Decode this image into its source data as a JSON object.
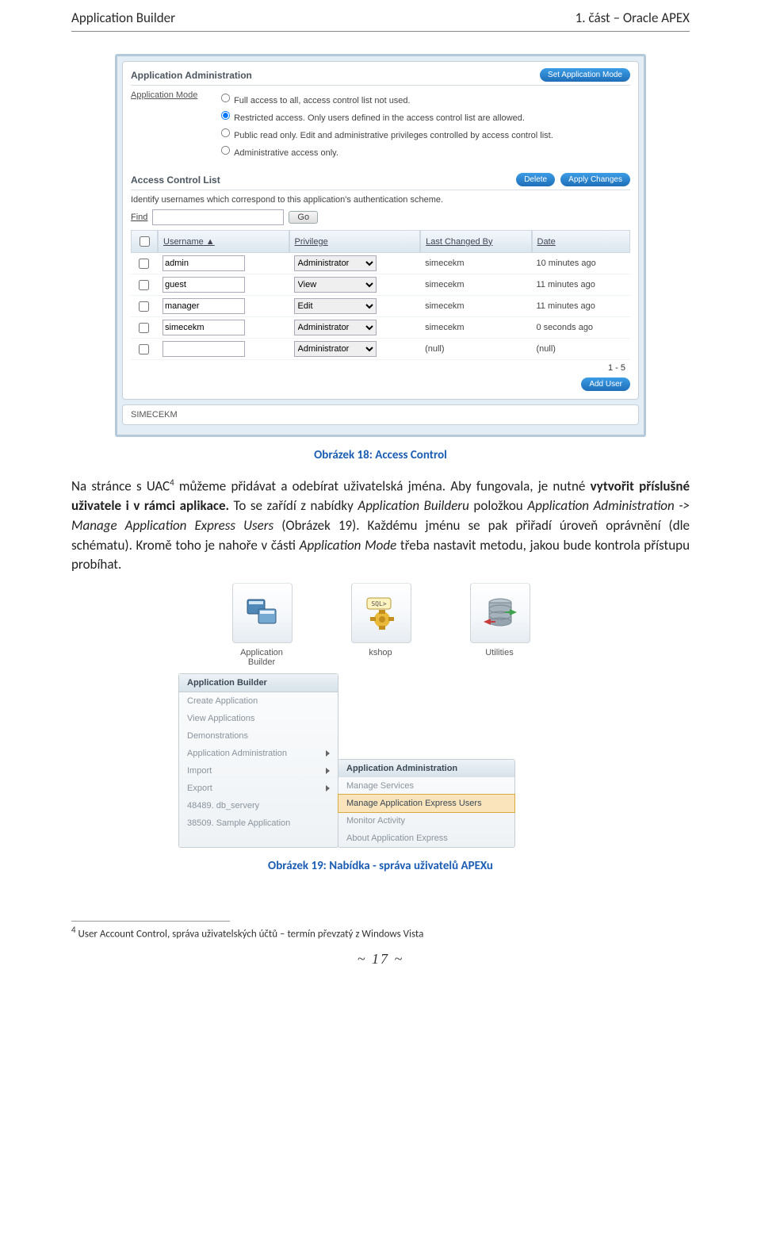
{
  "header": {
    "left": "Application Builder",
    "right": "1. část – Oracle APEX"
  },
  "caption1": "Obrázek 18: Access Control",
  "para1a": "Na stránce s UAC",
  "para1sup": "4",
  "para1b": " můžeme přidávat a odebírat uživatelská jména. Aby fungovala, je nutné ",
  "para1bold": "vytvořit příslušné uživatele i v rámci aplikace.",
  "para1c": " To se zařídí z nabídky ",
  "para1i1": "Application Builderu",
  "para1d": " položkou ",
  "para1i2": "Application Administration -> Manage Application Express Users",
  "para1e": " (Obrázek 19). Každému jménu se pak přiřadí úroveň oprávnění (dle schématu). Kromě toho je nahoře v části ",
  "para1i3": "Application Mode",
  "para1f": " třeba nastavit metodu, jakou bude kontrola přístupu probíhat.",
  "caption2": "Obrázek 19: Nabídka - správa uživatelů APEXu",
  "footnote_sup": "4",
  "footnote": " User Account Control, správa uživatelských účtů – termín převzatý z Windows Vista",
  "pagenum": "~ 17 ~",
  "s1": {
    "section_admin": "Application Administration",
    "btn_setmode": "Set Application Mode",
    "mode_label": "Application Mode",
    "radio1": "Full access to all, access control list not used.",
    "radio2": "Restricted access. Only users defined in the access control list are allowed.",
    "radio3": "Public read only. Edit and administrative privileges controlled by access control list.",
    "radio4": "Administrative access only.",
    "section_acl": "Access Control List",
    "btn_delete": "Delete",
    "btn_apply": "Apply Changes",
    "desc": "Identify usernames which correspond to this application's authentication scheme.",
    "find_label": "Find",
    "btn_go": "Go",
    "col_user": "Username",
    "col_priv": "Privilege",
    "col_changed": "Last Changed By",
    "col_date": "Date",
    "rows": [
      {
        "user": "admin",
        "priv": "Administrator",
        "by": "simecekm",
        "date": "10 minutes ago"
      },
      {
        "user": "guest",
        "priv": "View",
        "by": "simecekm",
        "date": "11 minutes ago"
      },
      {
        "user": "manager",
        "priv": "Edit",
        "by": "simecekm",
        "date": "11 minutes ago"
      },
      {
        "user": "simecekm",
        "priv": "Administrator",
        "by": "simecekm",
        "date": "0 seconds ago"
      },
      {
        "user": "",
        "priv": "Administrator",
        "by": "(null)",
        "date": "(null)"
      }
    ],
    "pagination": "1 - 5",
    "btn_adduser": "Add User",
    "footer_user": "SIMECEKM"
  },
  "s2": {
    "icon_ab": "Application Builder",
    "icon_ks": "kshop",
    "icon_ut": "Utilities",
    "menu": {
      "header": "Application Builder",
      "items": [
        "Create Application",
        "View Applications",
        "Demonstrations",
        "Application Administration",
        "Import",
        "Export",
        "48489. db_servery",
        "38509. Sample Application"
      ]
    },
    "submenu": {
      "header": "Application Administration",
      "items": [
        "Manage Services",
        "Manage Application Express Users",
        "Monitor Activity",
        "About Application Express"
      ]
    }
  }
}
